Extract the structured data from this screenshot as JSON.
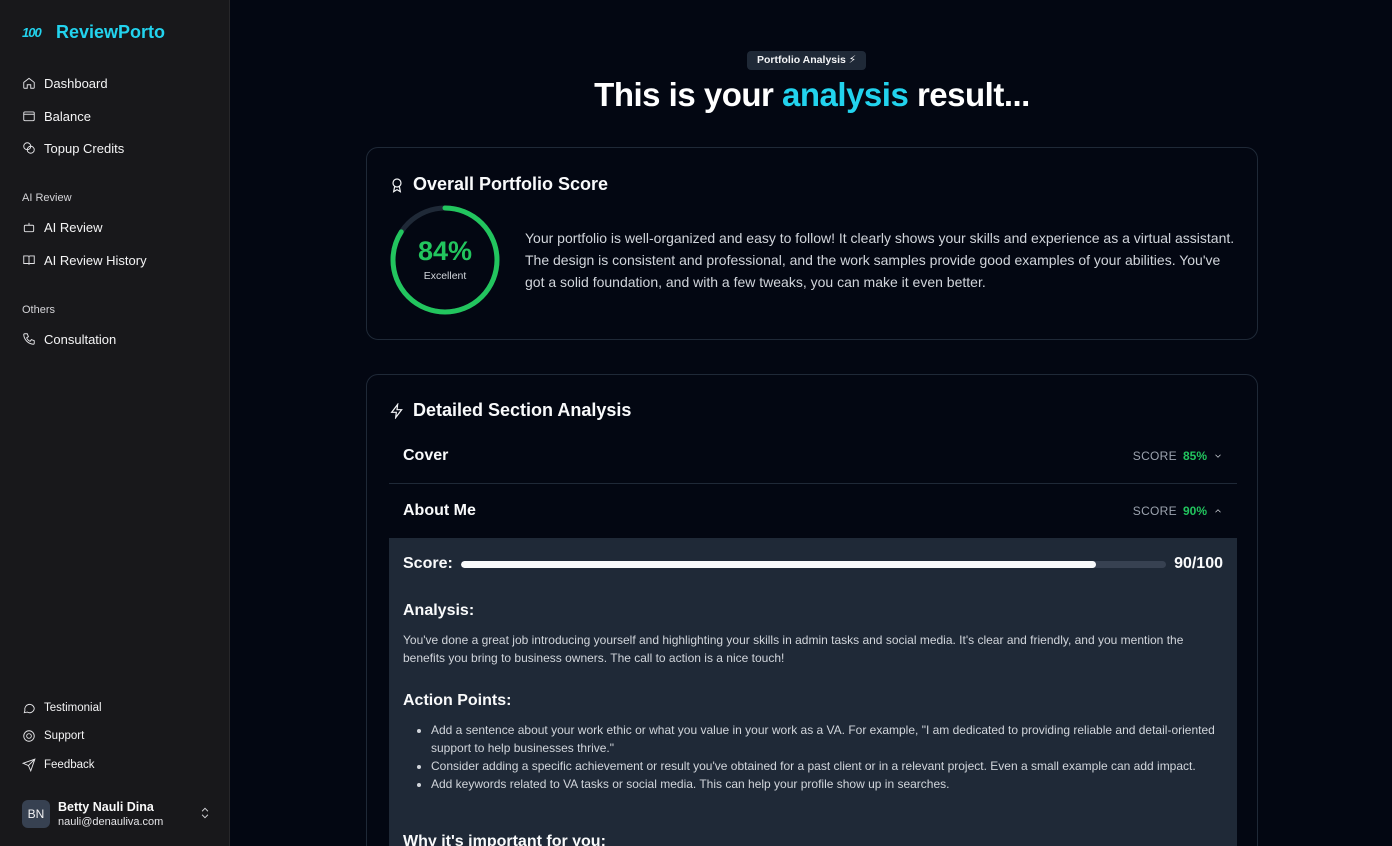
{
  "sidebar": {
    "brand_logo": "100",
    "brand_name": "ReviewPorto",
    "main_items": [
      {
        "label": "Dashboard",
        "icon": "home-icon"
      },
      {
        "label": "Balance",
        "icon": "wallet-icon"
      },
      {
        "label": "Topup Credits",
        "icon": "coins-icon"
      }
    ],
    "group_ai": "AI Review",
    "ai_items": [
      {
        "label": "AI Review",
        "icon": "bot-icon"
      },
      {
        "label": "AI Review History",
        "icon": "book-icon"
      }
    ],
    "group_others": "Others",
    "other_items": [
      {
        "label": "Consultation",
        "icon": "phone-icon"
      }
    ],
    "footer_items": [
      {
        "label": "Testimonial",
        "icon": "message-icon"
      },
      {
        "label": "Support",
        "icon": "lifebuoy-icon"
      },
      {
        "label": "Feedback",
        "icon": "send-icon"
      }
    ],
    "user": {
      "initials": "BN",
      "name": "Betty Nauli Dina",
      "email": "nauli@denauliva.com"
    }
  },
  "header": {
    "badge": "Portfolio Analysis ⚡",
    "title_before": "This is your ",
    "title_accent": "analysis",
    "title_after": " result..."
  },
  "overall": {
    "title": "Overall Portfolio Score",
    "score_pct": "84%",
    "score_fraction": 0.84,
    "score_label": "Excellent",
    "summary": "Your portfolio is well-organized and easy to follow! It clearly shows your skills and experience as a virtual assistant. The design is consistent and professional, and the work samples provide good examples of your abilities. You've got a solid foundation, and with a few tweaks, you can make it even better.",
    "colors": {
      "ring": "#22c55e",
      "ring_track": "#1f2937"
    }
  },
  "detailed": {
    "title": "Detailed Section Analysis",
    "score_label": "SCORE",
    "sections": [
      {
        "name": "Cover",
        "score": "85%",
        "expanded": false
      },
      {
        "name": "About Me",
        "score": "90%",
        "expanded": true
      }
    ],
    "expanded": {
      "score_label": "Score:",
      "score_value": 90,
      "score_text": "90/100",
      "analysis_title": "Analysis:",
      "analysis_text": "You've done a great job introducing yourself and highlighting your skills in admin tasks and social media. It's clear and friendly, and you mention the benefits you bring to business owners. The call to action is a nice touch!",
      "action_title": "Action Points:",
      "action_points": [
        "Add a sentence about your work ethic or what you value in your work as a VA. For example, \"I am dedicated to providing reliable and detail-oriented support to help businesses thrive.\"",
        "Consider adding a specific achievement or result you've obtained for a past client or in a relevant project. Even a small example can add impact.",
        "Add keywords related to VA tasks or social media. This can help your profile show up in searches."
      ],
      "why_title": "Why it's important for you:"
    }
  },
  "colors": {
    "accent": "#22d3ee",
    "success": "#22c55e",
    "background": "#030712",
    "sidebar": "#18181b"
  }
}
